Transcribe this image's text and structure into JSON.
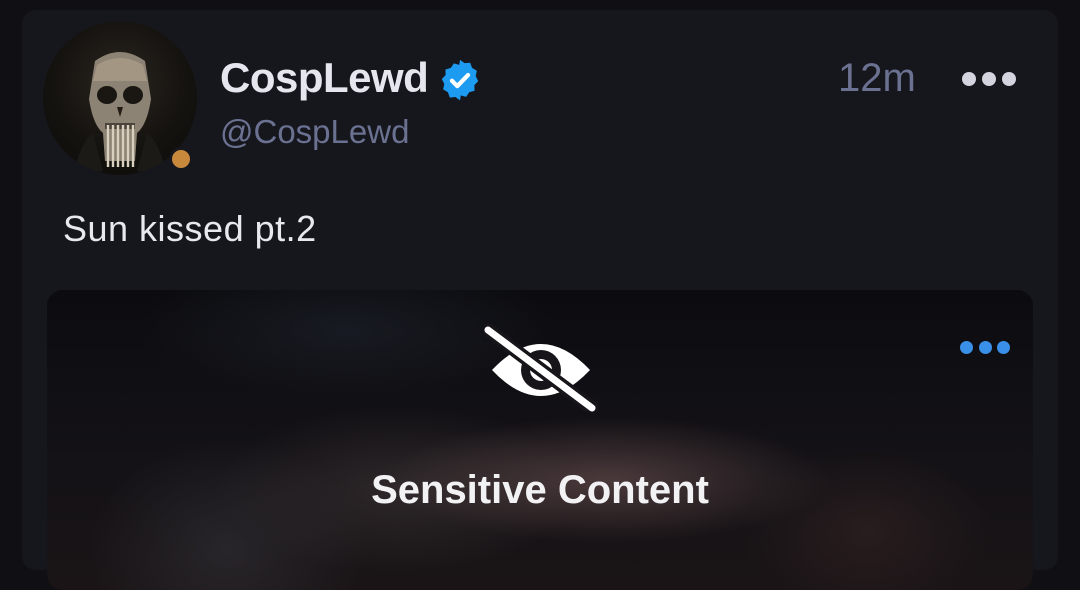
{
  "post": {
    "author": {
      "display_name": "CospLewd",
      "handle": "@CospLewd",
      "verified": true,
      "avatar_icon": "skull-mask-avatar",
      "status_color": "#c9893c"
    },
    "timestamp": "12m",
    "text": "Sun kissed pt.2",
    "media": {
      "sensitive_label": "Sensitive Content",
      "icon": "eye-off-icon",
      "menu_dot_color": "#3a8fe8"
    }
  },
  "colors": {
    "background": "#0f0f14",
    "card": "#16161d",
    "verified_badge": "#1d9bf0",
    "muted_text": "#6b7291"
  }
}
